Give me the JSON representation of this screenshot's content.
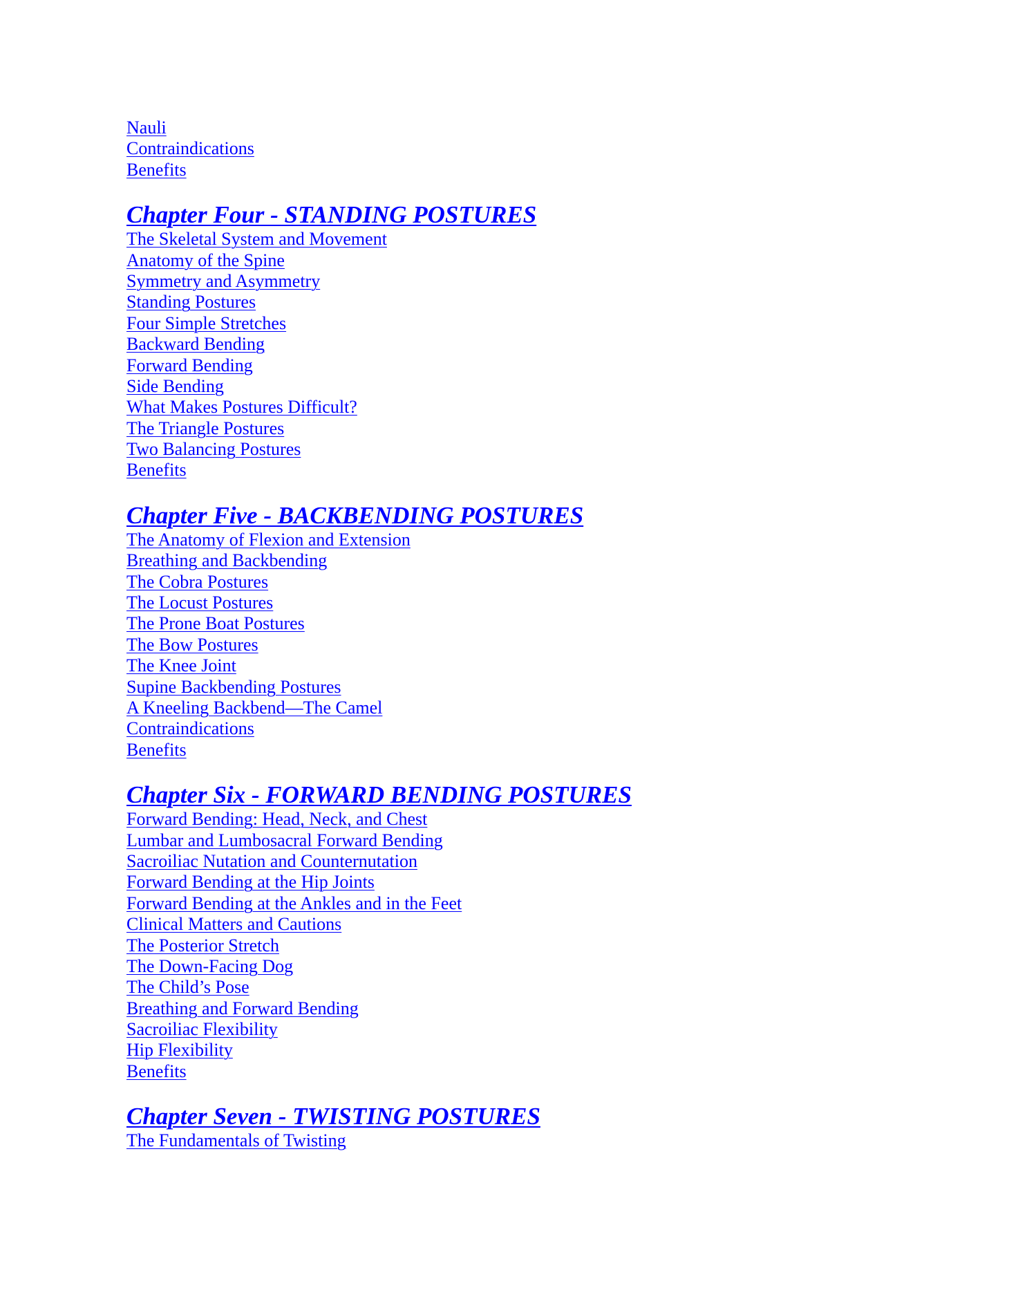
{
  "link_color": "#0000ff",
  "intro": {
    "items": [
      "Nauli",
      "Contraindications",
      "Benefits"
    ]
  },
  "chapters": [
    {
      "title": "Chapter Four - STANDING POSTURES",
      "items": [
        "The Skeletal System and Movement",
        "Anatomy of the Spine",
        "Symmetry and Asymmetry",
        "Standing Postures",
        "Four Simple Stretches",
        "Backward Bending",
        "Forward Bending",
        "Side Bending",
        "What Makes Postures Difficult?",
        "The Triangle Postures",
        "Two Balancing Postures",
        "Benefits"
      ]
    },
    {
      "title": "Chapter Five - BACKBENDING POSTURES",
      "items": [
        "The Anatomy of Flexion and Extension",
        "Breathing and Backbending",
        "The Cobra Postures",
        "The Locust Postures",
        "The Prone Boat Postures",
        "The Bow Postures",
        "The Knee Joint",
        "Supine Backbending Postures",
        "A Kneeling Backbend—The Camel",
        "Contraindications",
        "Benefits"
      ]
    },
    {
      "title": "Chapter Six - FORWARD BENDING POSTURES",
      "items": [
        "Forward Bending: Head, Neck, and Chest",
        "Lumbar and Lumbosacral Forward Bending",
        "Sacroiliac Nutation and Counternutation",
        "Forward Bending at the Hip Joints",
        "Forward Bending at the Ankles and in the Feet",
        "Clinical Matters and Cautions",
        "The Posterior Stretch",
        "The Down-Facing Dog",
        "The Child’s Pose",
        "Breathing and Forward Bending",
        "Sacroiliac Flexibility",
        "Hip Flexibility",
        "Benefits"
      ]
    },
    {
      "title": "Chapter Seven - TWISTING POSTURES",
      "items": [
        "The Fundamentals of Twisting"
      ]
    }
  ]
}
